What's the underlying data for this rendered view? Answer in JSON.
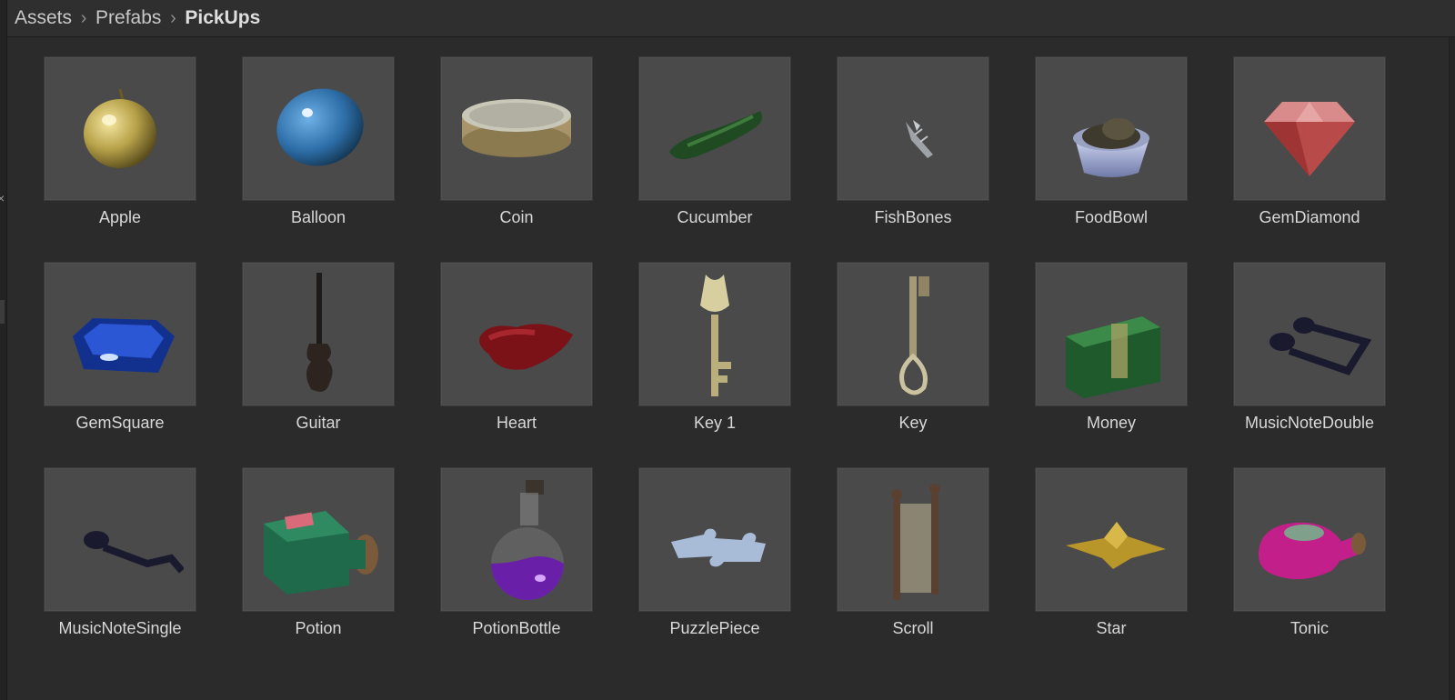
{
  "breadcrumb": {
    "items": [
      "Assets",
      "Prefabs",
      "PickUps"
    ]
  },
  "colors": {
    "background": "#2b2b2b",
    "thumbnail": "#4a4a4a",
    "label": "#d8d8d8"
  },
  "assets": [
    {
      "name": "Apple",
      "icon": "apple-icon"
    },
    {
      "name": "Balloon",
      "icon": "balloon-icon"
    },
    {
      "name": "Coin",
      "icon": "coin-icon"
    },
    {
      "name": "Cucumber",
      "icon": "cucumber-icon"
    },
    {
      "name": "FishBones",
      "icon": "fishbones-icon"
    },
    {
      "name": "FoodBowl",
      "icon": "foodbowl-icon"
    },
    {
      "name": "GemDiamond",
      "icon": "gem-diamond-icon"
    },
    {
      "name": "GemSquare",
      "icon": "gem-square-icon"
    },
    {
      "name": "Guitar",
      "icon": "guitar-icon"
    },
    {
      "name": "Heart",
      "icon": "heart-icon"
    },
    {
      "name": "Key 1",
      "icon": "key-1-icon"
    },
    {
      "name": "Key",
      "icon": "key-icon"
    },
    {
      "name": "Money",
      "icon": "money-icon"
    },
    {
      "name": "MusicNoteDouble",
      "icon": "music-note-double-icon"
    },
    {
      "name": "MusicNoteSingle",
      "icon": "music-note-single-icon"
    },
    {
      "name": "Potion",
      "icon": "potion-icon"
    },
    {
      "name": "PotionBottle",
      "icon": "potion-bottle-icon"
    },
    {
      "name": "PuzzlePiece",
      "icon": "puzzle-piece-icon"
    },
    {
      "name": "Scroll",
      "icon": "scroll-icon"
    },
    {
      "name": "Star",
      "icon": "star-icon"
    },
    {
      "name": "Tonic",
      "icon": "tonic-icon"
    }
  ]
}
